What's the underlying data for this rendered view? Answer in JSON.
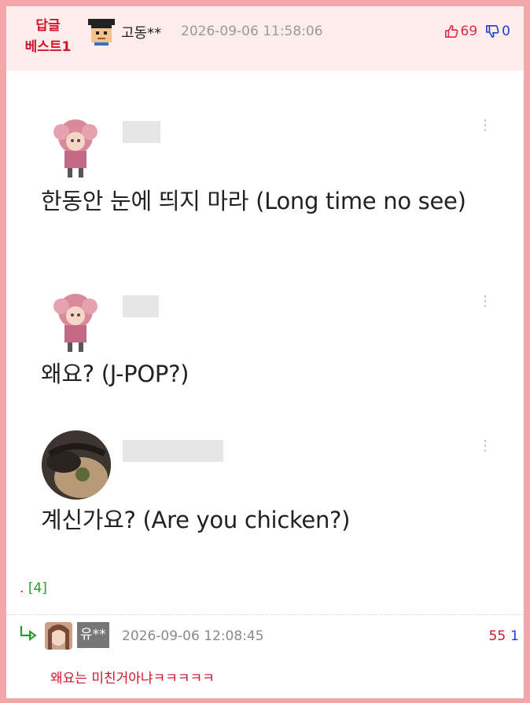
{
  "best_comment": {
    "badge_line1": "답글",
    "badge_line2": "베스트1",
    "nickname": "고동**",
    "timestamp": "2026-09-06 11:58:06",
    "upvotes": "69",
    "downvotes": "0"
  },
  "embedded_screenshot": {
    "tweets": [
      {
        "text": "한동안 눈에 띄지 마라 (Long time no see)"
      },
      {
        "text": "왜요? (J-POP?)"
      },
      {
        "text": "계신가요? (Are you chicken?)"
      }
    ],
    "image_count_prefix": ".",
    "image_count": "[4]"
  },
  "reply": {
    "nickname": "유**",
    "timestamp": "2026-09-06 12:08:45",
    "upvotes": "55",
    "downvotes": "1",
    "text": "왜요는 미친거아냐ㅋㅋㅋㅋㅋ"
  },
  "icons": {
    "thumb_up": "thumbs-up-icon",
    "thumb_down": "thumbs-down-icon",
    "reply_arrow": "reply-arrow-icon",
    "more": "more-vertical-icon"
  },
  "colors": {
    "border": "#f4a7a9",
    "header_bg": "#fdecec",
    "best_red": "#d0142c",
    "down_blue": "#1b3fd6",
    "count_green": "#2a9a2a"
  }
}
